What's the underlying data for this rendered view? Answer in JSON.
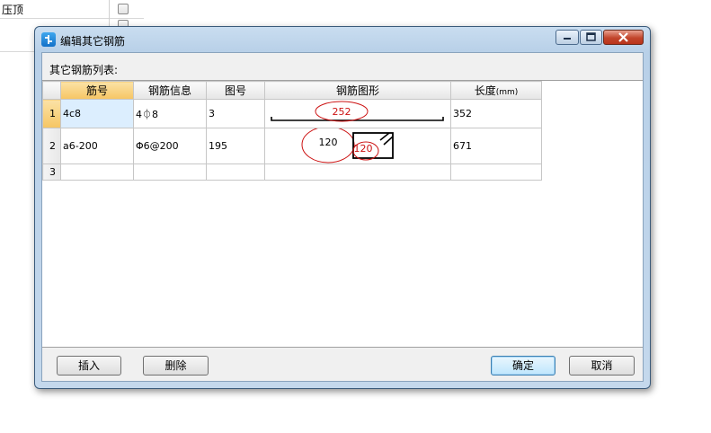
{
  "background": {
    "row1_text": "压顶"
  },
  "dialog": {
    "title": "编辑其它钢筋",
    "list_label": "其它钢筋列表:",
    "columns": [
      "筋号",
      "钢筋信息",
      "图号",
      "钢筋图形",
      "长度",
      "(mm)"
    ],
    "rows": [
      {
        "num": "1",
        "bar_no": "4c8",
        "info": "4⏀8",
        "fig_no": "3",
        "length": "352",
        "shape_label": "252"
      },
      {
        "num": "2",
        "bar_no": "a6-200",
        "info": "Φ6@200",
        "fig_no": "195",
        "length": "671",
        "shape_label_a": "120",
        "shape_label_b": "120"
      },
      {
        "num": "3",
        "bar_no": "",
        "info": "",
        "fig_no": "",
        "length": ""
      }
    ],
    "buttons": {
      "insert": "插入",
      "delete": "删除",
      "ok": "确定",
      "cancel": "取消"
    }
  },
  "colors": {
    "annotation_red": "#cc1111",
    "header_selected": "#f6c563"
  }
}
